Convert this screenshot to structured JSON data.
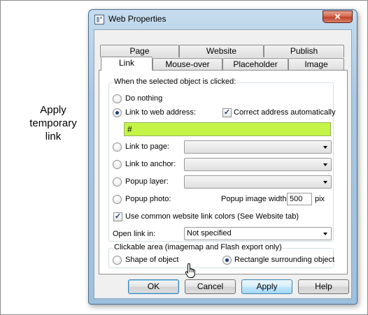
{
  "caption": {
    "line1": "Apply",
    "line2": "temporary",
    "line3": "link"
  },
  "window": {
    "title": "Web Properties",
    "close_symbol": "✕"
  },
  "tabs": {
    "row1": [
      "Page",
      "Website",
      "Publish"
    ],
    "row2": [
      "Link",
      "Mouse-over",
      "Placeholder",
      "Image"
    ],
    "active": "Link"
  },
  "click_group": {
    "title": "When the selected object is clicked:",
    "do_nothing": "Do nothing",
    "link_to_web_address": "Link to web address:",
    "correct_address": "Correct address automatically",
    "correct_address_checked": true,
    "url_value": "#",
    "link_to_page": "Link to page:",
    "link_to_anchor": "Link to anchor:",
    "popup_layer": "Popup layer:",
    "popup_photo": "Popup photo:",
    "popup_image_width_label": "Popup image width",
    "popup_image_width_value": "500",
    "popup_image_width_unit": "pix",
    "selected_option": "link_to_web_address",
    "common_colors": "Use common website link colors (See Website tab)",
    "common_colors_checked": true,
    "open_link_in_label": "Open link in:",
    "open_link_in_value": "Not specified"
  },
  "clickable_group": {
    "title": "Clickable area (imagemap and Flash export only)",
    "shape_of_object": "Shape of object",
    "rectangle": "Rectangle surrounding object",
    "selected_option": "rectangle"
  },
  "buttons": {
    "ok": "OK",
    "cancel": "Cancel",
    "apply": "Apply",
    "help": "Help"
  },
  "colors": {
    "url_highlight": "#c3f446",
    "title_bar": "#aac8e1",
    "close_button": "#c2432a"
  }
}
